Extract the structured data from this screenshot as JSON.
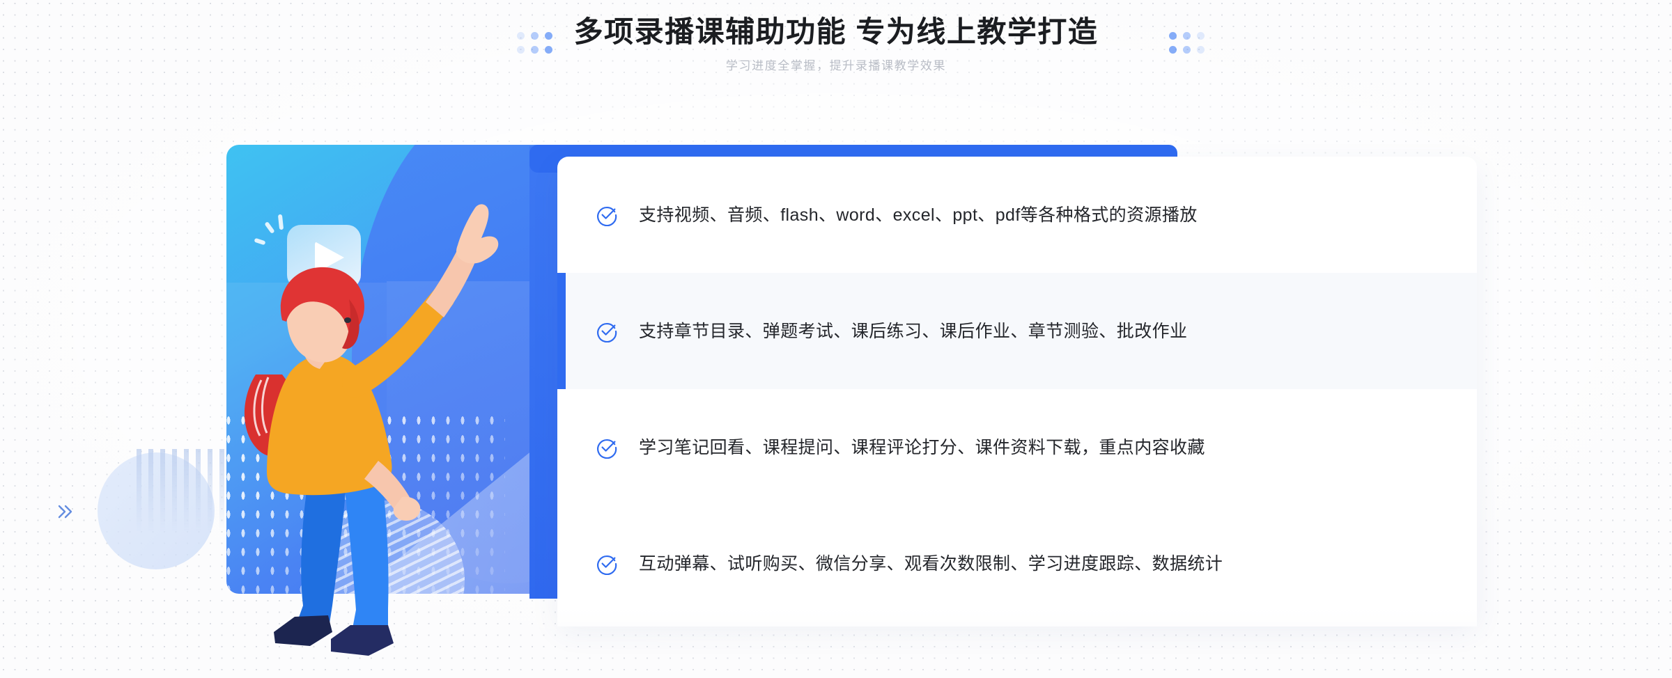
{
  "header": {
    "title": "多项录播课辅助功能 专为线上教学打造",
    "subtitle": "学习进度全掌握，提升录播课教学效果"
  },
  "decor": {
    "dot_cluster_left": "dot-grid-decoration",
    "dot_cluster_right": "dot-grid-decoration",
    "chevron_left": "chevron-double-right-icon",
    "chevron_card": "chevron-double-left-icon",
    "pale_circle": "circle-decoration"
  },
  "illustration": {
    "name": "online-course-illustration",
    "play_bubble": "play-button-speech-bubble",
    "character": "woman-pointing-up",
    "colors": {
      "card_start": "#3fc2f2",
      "card_end": "#3463ef",
      "shirt": "#f5a623",
      "hair": "#e03434",
      "pants": "#2f7df0",
      "shoes": "#1f2a5e",
      "skin": "#f7c6ad"
    }
  },
  "features": {
    "accent_color": "#2f6bf0",
    "highlight_bg": "#f7f9fc",
    "items": [
      {
        "icon": "check-circle-icon",
        "text": "支持视频、音频、flash、word、excel、ppt、pdf等各种格式的资源播放",
        "highlight": false
      },
      {
        "icon": "check-circle-icon",
        "text": "支持章节目录、弹题考试、课后练习、课后作业、章节测验、批改作业",
        "highlight": true
      },
      {
        "icon": "check-circle-icon",
        "text": "学习笔记回看、课程提问、课程评论打分、课件资料下载，重点内容收藏",
        "highlight": false
      },
      {
        "icon": "check-circle-icon",
        "text": "互动弹幕、试听购买、微信分享、观看次数限制、学习进度跟踪、数据统计",
        "highlight": false
      }
    ]
  }
}
